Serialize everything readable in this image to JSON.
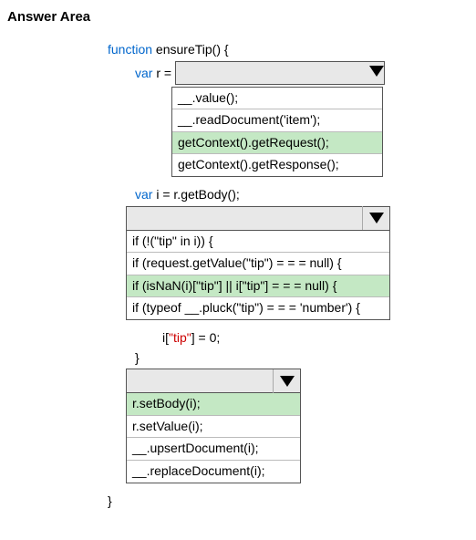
{
  "header": "Answer Area",
  "code": {
    "fn_decl_kw": "function",
    "fn_name": " ensureTip() {",
    "var_kw": "var",
    "r_assign": " r = ",
    "i_assign": " i = r.getBody();",
    "tip_line_pre": "i[",
    "tip_str": "\"tip\"",
    "tip_line_post": "] = 0;",
    "brace_close": "}",
    "brace_close_outer": "}"
  },
  "dropdown1": {
    "options": [
      "__.value();",
      "__.readDocument('item');",
      "getContext().getRequest();",
      "getContext().getResponse();"
    ],
    "selectedIndex": 2
  },
  "dropdown2": {
    "options": [
      "if (!(\"tip\" in i)) {",
      "if (request.getValue(\"tip\") = = = null) {",
      "if (isNaN(i)[\"tip\"] || i[\"tip\"] = = = null) {",
      "if (typeof __.pluck(\"tip\") = = = 'number') {"
    ],
    "selectedIndex": 2
  },
  "dropdown3": {
    "options": [
      "r.setBody(i);",
      "r.setValue(i);",
      "__.upsertDocument(i);",
      "__.replaceDocument(i);"
    ],
    "selectedIndex": 0
  }
}
